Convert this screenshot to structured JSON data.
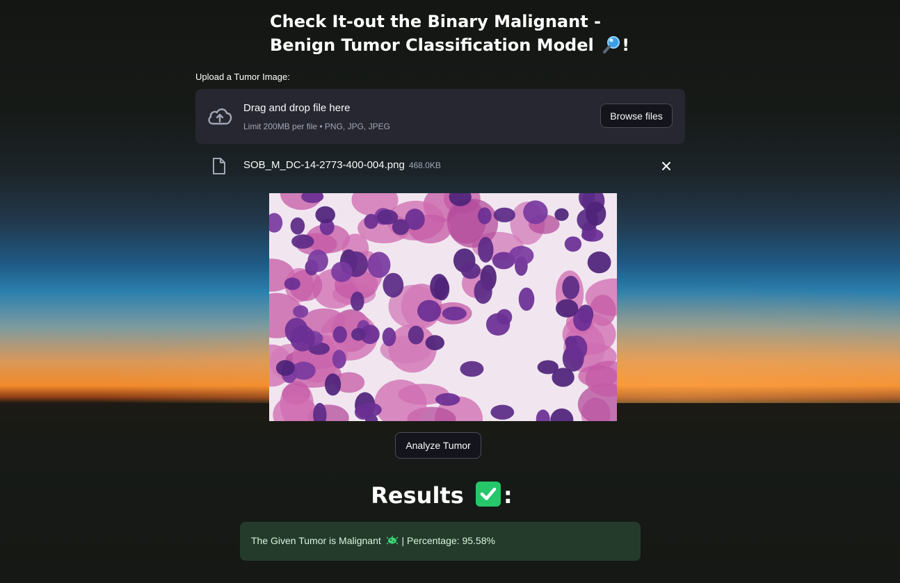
{
  "header": {
    "title_line1": "Check It-out the Binary Malignant -",
    "title_line2_text": "Benign Tumor Classification Model",
    "title_suffix": "!",
    "title_icon": "magnifying-glass-icon"
  },
  "uploader": {
    "label": "Upload a Tumor Image:",
    "dropzone_title": "Drag and drop file here",
    "dropzone_subtitle": "Limit 200MB per file • PNG, JPG, JPEG",
    "browse_label": "Browse files",
    "icon": "cloud-upload-icon"
  },
  "uploaded_file": {
    "name": "SOB_M_DC-14-2773-400-004.png",
    "size": "468.0KB",
    "icon": "file-icon",
    "remove_icon": "close-icon"
  },
  "analyze": {
    "label": "Analyze Tumor"
  },
  "results": {
    "heading": "Results",
    "heading_suffix": ":",
    "heading_icon": "check-mark-icon",
    "message_prefix": "The Given Tumor is Malignant",
    "message_icon": "microbe-icon",
    "message_suffix": "| Percentage: 95.58%"
  },
  "colors": {
    "dropzone_bg": "#262730",
    "success_bg": "#243b2b",
    "success_text": "#d8f5df",
    "check_green": "#26c66b"
  }
}
